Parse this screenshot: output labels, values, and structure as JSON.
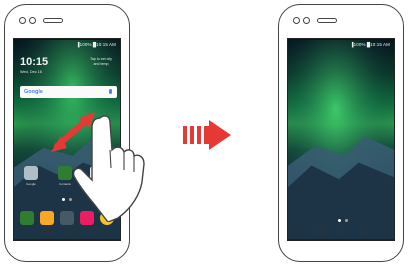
{
  "left_phone": {
    "status_bar": "▐100% █10:15 AM",
    "lock_time": "10:15",
    "lock_date": "Wed, Dec 16",
    "weather_text": "Tap to set city\nand temp",
    "search_brand": "Google",
    "app_labels": [
      "Google",
      "Contacts",
      ""
    ],
    "colors": {
      "contacts_icon": "#2e7d32",
      "phone_icon": "#2e7d32",
      "messages_icon": "#f9a825",
      "camera_icon": "#455a64",
      "gallery_icon": "#e91e63",
      "chrome_icon": "#fbc02d"
    }
  },
  "right_phone": {
    "status_bar": "▐100% █10:15 AM"
  },
  "hardware_nav": {
    "back": "◁",
    "home": "○",
    "recents": "□"
  },
  "icons": {
    "swipe_arrow": "double-headed-diagonal-arrow",
    "hand": "pointing-hand-gesture",
    "transition": "right-arrow"
  }
}
